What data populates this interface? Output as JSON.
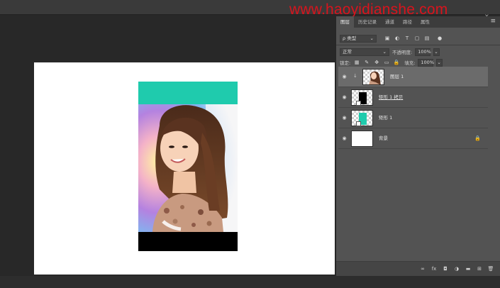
{
  "watermark": "www.haoyidianshe.com",
  "window": {
    "close_glyph": "×"
  },
  "panel": {
    "tabs": [
      {
        "label": "图层",
        "active": true
      },
      {
        "label": "历史记录",
        "active": false
      },
      {
        "label": "通道",
        "active": false
      },
      {
        "label": "路径",
        "active": false
      },
      {
        "label": "属性",
        "active": false
      }
    ],
    "menu_glyph": "≡",
    "filter": {
      "search_glyph": "ρ",
      "kind_label": "类型",
      "icons": [
        "image-filter-icon",
        "adjustment-filter-icon",
        "type-filter-icon",
        "shape-filter-icon",
        "smart-object-filter-icon"
      ]
    },
    "blend": {
      "mode": "正常",
      "opacity_label": "不透明度:",
      "opacity_value": "100%"
    },
    "lock": {
      "label": "锁定:",
      "fill_label": "填充:",
      "fill_value": "100%"
    },
    "layers": [
      {
        "name": "图层 1",
        "selected": true,
        "clipped": true,
        "thumb": "photo"
      },
      {
        "name": "矩形 1 拷贝",
        "selected": false,
        "thumb": "black"
      },
      {
        "name": "矩形 1",
        "selected": false,
        "thumb": "teal"
      },
      {
        "name": "背景",
        "selected": false,
        "thumb": "white",
        "locked": true
      }
    ],
    "bottom_icons": [
      "link-layers-icon",
      "layer-style-icon",
      "add-mask-icon",
      "adjustment-layer-icon",
      "new-group-icon",
      "new-layer-icon",
      "delete-layer-icon"
    ]
  },
  "artwork": {
    "top_color": "#1fcbad",
    "bottom_color": "#000000"
  }
}
